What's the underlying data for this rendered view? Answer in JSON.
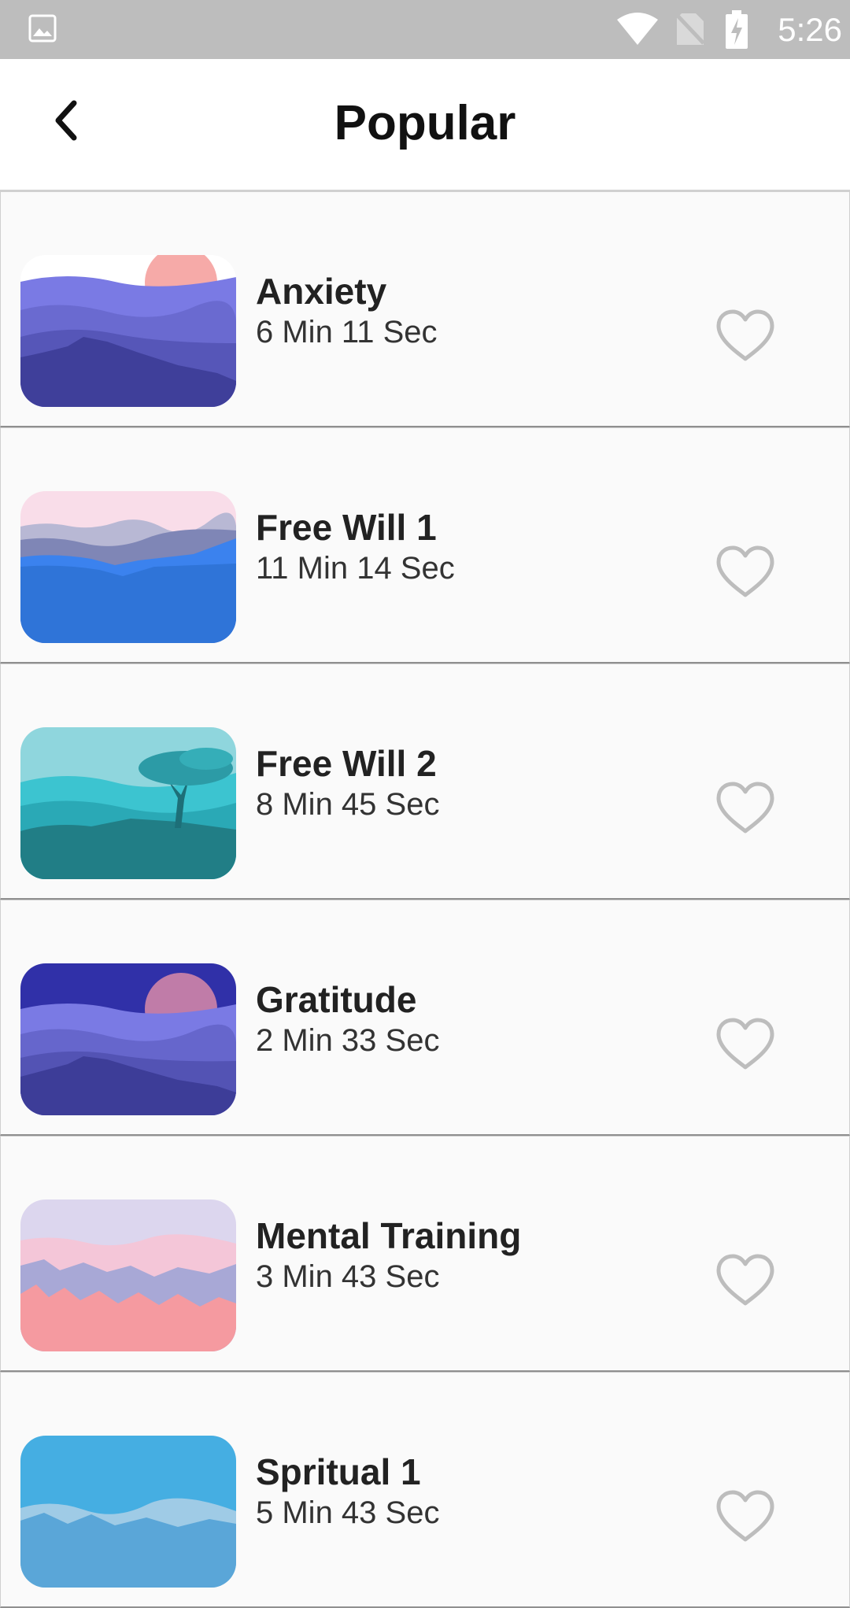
{
  "status_bar": {
    "time": "5:26",
    "icons": [
      "gallery-icon",
      "wifi-icon",
      "no-sim-icon",
      "battery-charging-icon"
    ]
  },
  "header": {
    "title": "Popular",
    "back_icon": "chevron-left-icon"
  },
  "colors": {
    "status_bar": "#bdbdbd",
    "row_background": "#fafafa",
    "heart_outline": "#bdbdbd"
  },
  "sessions": [
    {
      "title": "Anxiety",
      "duration": "6 Min 11 Sec",
      "favorite_icon": "heart-outline-icon"
    },
    {
      "title": "Free Will 1",
      "duration": "11 Min 14 Sec",
      "favorite_icon": "heart-outline-icon"
    },
    {
      "title": "Free Will 2",
      "duration": "8 Min 45 Sec",
      "favorite_icon": "heart-outline-icon"
    },
    {
      "title": "Gratitude",
      "duration": "2 Min 33 Sec",
      "favorite_icon": "heart-outline-icon"
    },
    {
      "title": "Mental Training",
      "duration": "3 Min 43 Sec",
      "favorite_icon": "heart-outline-icon"
    },
    {
      "title": "Spritual 1",
      "duration": "5 Min 43 Sec",
      "favorite_icon": "heart-outline-icon"
    }
  ]
}
